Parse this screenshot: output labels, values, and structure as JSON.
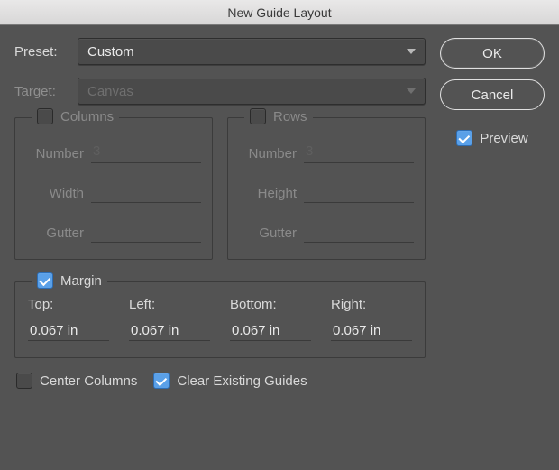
{
  "title": "New Guide Layout",
  "preset": {
    "label": "Preset:",
    "value": "Custom"
  },
  "target": {
    "label": "Target:",
    "value": "Canvas",
    "enabled": false
  },
  "buttons": {
    "ok": "OK",
    "cancel": "Cancel"
  },
  "preview": {
    "label": "Preview",
    "checked": true
  },
  "columns": {
    "label": "Columns",
    "checked": false,
    "fields": {
      "number": {
        "label": "Number",
        "value": "3"
      },
      "width": {
        "label": "Width",
        "value": ""
      },
      "gutter": {
        "label": "Gutter",
        "value": ""
      }
    }
  },
  "rows": {
    "label": "Rows",
    "checked": false,
    "fields": {
      "number": {
        "label": "Number",
        "value": "3"
      },
      "height": {
        "label": "Height",
        "value": ""
      },
      "gutter": {
        "label": "Gutter",
        "value": ""
      }
    }
  },
  "margin": {
    "label": "Margin",
    "checked": true,
    "top": {
      "label": "Top:",
      "value": "0.067 in"
    },
    "left": {
      "label": "Left:",
      "value": "0.067 in"
    },
    "bottom": {
      "label": "Bottom:",
      "value": "0.067 in"
    },
    "right": {
      "label": "Right:",
      "value": "0.067 in"
    }
  },
  "centerColumns": {
    "label": "Center Columns",
    "checked": false
  },
  "clearExisting": {
    "label": "Clear Existing Guides",
    "checked": true
  }
}
